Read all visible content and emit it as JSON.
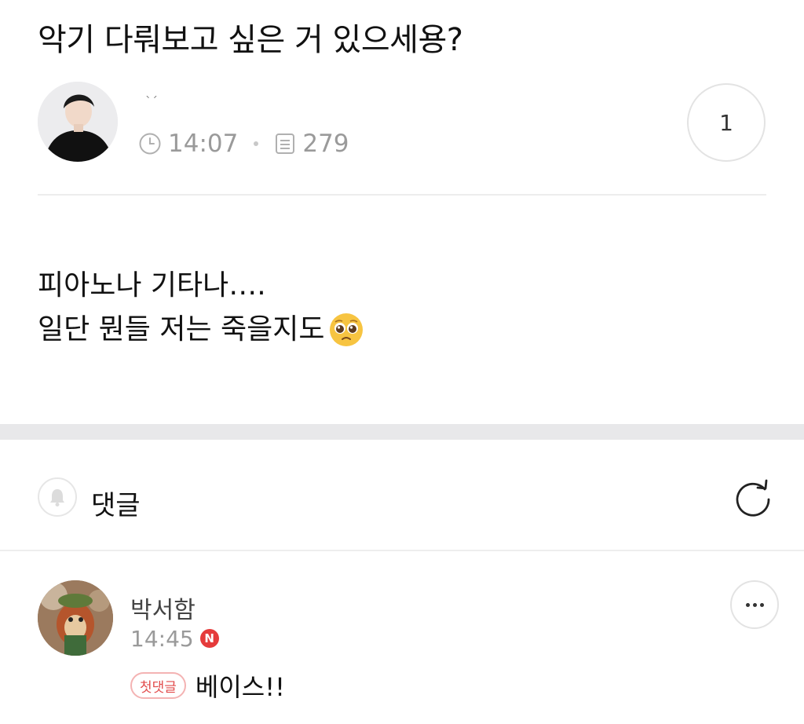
{
  "post": {
    "title": "악기 다뤄보고 싶은 거 있으세용?",
    "author_name": "ˋˊ",
    "time": "14:07",
    "views": "279",
    "comment_count": "1",
    "body_lines": [
      "피아노나 기타나….",
      "일단 뭔들 저는 죽을지도"
    ],
    "body_emoji": "pleading-face-emoji"
  },
  "comments_section": {
    "label": "댓글",
    "icons": {
      "bell": "bell-icon",
      "refresh": "refresh-icon"
    }
  },
  "comments": [
    {
      "author": "박서함",
      "time": "14:45",
      "new_badge": "N",
      "first_badge": "첫댓글",
      "text": "베이스!!"
    }
  ],
  "icons": {
    "clock": "clock-icon",
    "views": "document-icon",
    "more": "more-icon"
  },
  "colors": {
    "accent_red": "#e53b3b",
    "badge_border": "#f4b3b3",
    "muted": "#9a9a9a",
    "separator": "#e8e8ea"
  }
}
